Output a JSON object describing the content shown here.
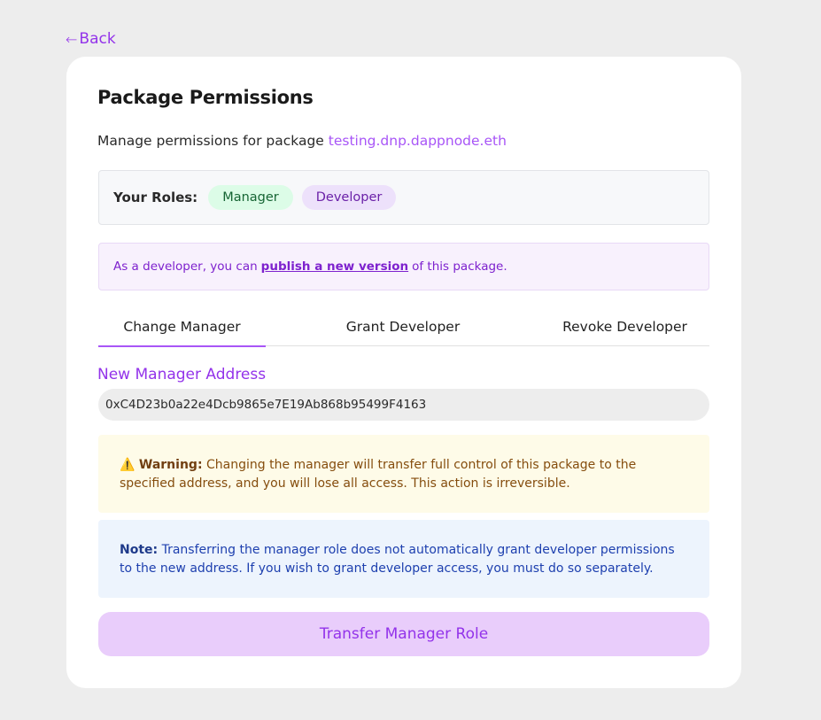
{
  "back": {
    "arrow": "←",
    "label": "Back"
  },
  "page": {
    "title": "Package Permissions",
    "subtitle_prefix": "Manage permissions for package",
    "package_name": "testing.dnp.dappnode.eth"
  },
  "roles": {
    "label": "Your Roles:",
    "items": [
      "Manager",
      "Developer"
    ]
  },
  "info": {
    "prefix": "As a developer, you can",
    "link": "publish a new version",
    "suffix": "of this package."
  },
  "tabs": [
    {
      "label": "Change Manager",
      "active": true
    },
    {
      "label": "Grant Developer",
      "active": false
    },
    {
      "label": "Revoke Developer",
      "active": false
    }
  ],
  "form": {
    "label": "New Manager Address",
    "value": "0xC4D23b0a22e4Dcb9865e7E19Ab868b95499F4163"
  },
  "warning": {
    "icon": "⚠️",
    "title": "Warning:",
    "text": "Changing the manager will transfer full control of this package to the specified address, and you will lose all access. This action is irreversible."
  },
  "note": {
    "title": "Note:",
    "text": "Transferring the manager role does not automatically grant developer permissions to the new address. If you wish to grant developer access, you must do so separately."
  },
  "submit": {
    "label": "Transfer Manager Role"
  },
  "colors": {
    "accent": "#a855f7",
    "warning_bg": "#fefbe8",
    "note_bg": "#edf4fd",
    "manager_badge": "#dcfce7",
    "developer_badge": "#ede1fb"
  }
}
